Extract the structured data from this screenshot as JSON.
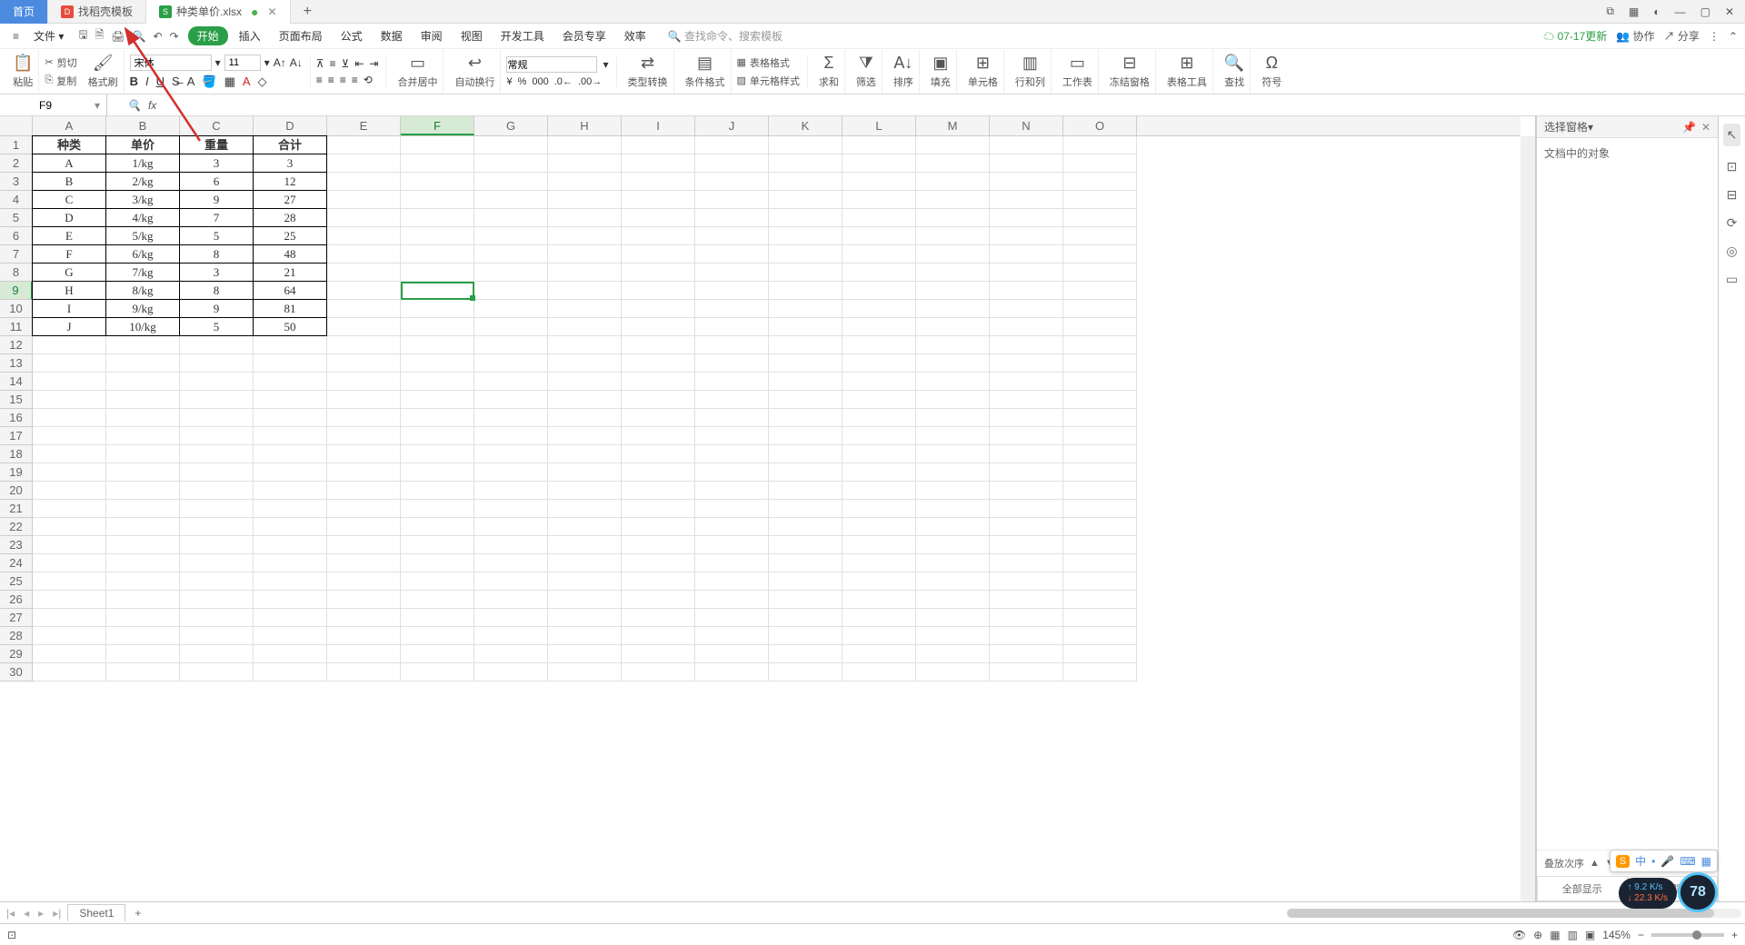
{
  "tabs": {
    "home": "首页",
    "template": "找稻壳模板",
    "file": "种类单价.xlsx"
  },
  "menu": {
    "file": "文件",
    "items": [
      "开始",
      "插入",
      "页面布局",
      "公式",
      "数据",
      "审阅",
      "视图",
      "开发工具",
      "会员专享",
      "效率"
    ],
    "search": "查找命令、搜索模板",
    "update": "07-17更新",
    "coop": "协作",
    "share": "分享"
  },
  "ribbon": {
    "paste": "粘贴",
    "cut": "剪切",
    "copy": "复制",
    "format_painter": "格式刷",
    "font_name": "宋体",
    "font_size": "11",
    "merge": "合并居中",
    "wrap": "自动换行",
    "number_fmt": "常规",
    "type_convert": "类型转换",
    "cond_fmt": "条件格式",
    "table_style": "表格格式",
    "cell_style": "单元格样式",
    "sum": "求和",
    "filter": "筛选",
    "sort": "排序",
    "fill": "填充",
    "cells": "单元格",
    "rowcol": "行和列",
    "sheet": "工作表",
    "freeze": "冻结窗格",
    "table_tools": "表格工具",
    "find": "查找",
    "symbol": "符号"
  },
  "cell_ref": "F9",
  "columns": [
    "A",
    "B",
    "C",
    "D",
    "E",
    "F",
    "G",
    "H",
    "I",
    "J",
    "K",
    "L",
    "M",
    "N",
    "O"
  ],
  "sel_col_idx": 5,
  "sel_row_idx": 8,
  "row_count": 30,
  "table": {
    "headers": [
      "种类",
      "单价",
      "重量",
      "合计"
    ],
    "rows": [
      [
        "A",
        "1/kg",
        "3",
        "3"
      ],
      [
        "B",
        "2/kg",
        "6",
        "12"
      ],
      [
        "C",
        "3/kg",
        "9",
        "27"
      ],
      [
        "D",
        "4/kg",
        "7",
        "28"
      ],
      [
        "E",
        "5/kg",
        "5",
        "25"
      ],
      [
        "F",
        "6/kg",
        "8",
        "48"
      ],
      [
        "G",
        "7/kg",
        "3",
        "21"
      ],
      [
        "H",
        "8/kg",
        "8",
        "64"
      ],
      [
        "I",
        "9/kg",
        "9",
        "81"
      ],
      [
        "J",
        "10/kg",
        "5",
        "50"
      ]
    ]
  },
  "right_panel": {
    "title": "选择窗格",
    "body": "文档中的对象",
    "order": "叠放次序",
    "show_all": "全部显示",
    "hide_all": "全部隐藏"
  },
  "sheet": {
    "name": "Sheet1"
  },
  "status": {
    "zoom": "145%"
  },
  "overlay": {
    "speed_up": "9.2",
    "speed_down": "22.3",
    "speed_unit": "K/s",
    "pct": "78"
  }
}
